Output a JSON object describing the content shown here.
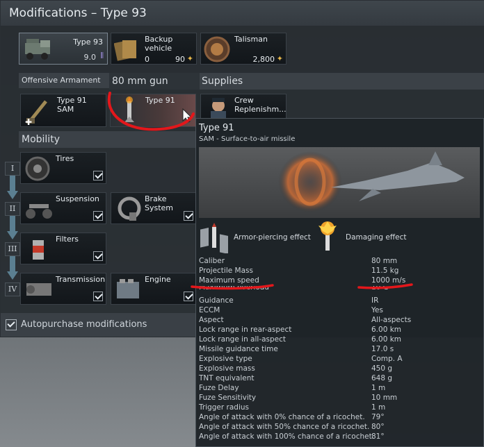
{
  "window": {
    "title": "Modifications – Type 93"
  },
  "top_cards": [
    {
      "name": "Type 93",
      "value": "9.0",
      "icon": "truck-icon"
    },
    {
      "name": "Backup vehicle",
      "count": "0",
      "price": "90",
      "icon": "cards-icon"
    },
    {
      "name": "Talisman",
      "price": "2,800",
      "icon": "medal-icon"
    }
  ],
  "sections": {
    "offensive": "Offensive Armament",
    "gun": "80 mm gun",
    "supplies": "Supplies",
    "mobility": "Mobility"
  },
  "weapons": [
    {
      "name": "Type 91",
      "sub": "SAM",
      "icon": "sam-launcher-icon"
    },
    {
      "name": "Type 91",
      "icon": "missile-icon"
    }
  ],
  "supplies": [
    {
      "name": "Crew Replenishm...",
      "icon": "crew-icon"
    }
  ],
  "mobility": [
    {
      "name": "Tires",
      "icon": "tire-icon"
    },
    {
      "name": "Suspension",
      "icon": "suspension-icon"
    },
    {
      "name": "Brake System",
      "icon": "brake-icon"
    },
    {
      "name": "Filters",
      "icon": "filter-icon"
    },
    {
      "name": "Transmission",
      "icon": "transmission-icon"
    },
    {
      "name": "Engine",
      "icon": "engine-icon"
    }
  ],
  "tiers": [
    "I",
    "II",
    "III",
    "IV"
  ],
  "autopurchase": "Autopurchase modifications",
  "tooltip": {
    "title": "Type 91",
    "subtitle": "SAM - Surface-to-air missile",
    "effects": [
      "Armor-piercing effect",
      "Damaging effect"
    ],
    "stats": [
      [
        "Caliber",
        "80 mm"
      ],
      [
        "Projectile Mass",
        "11.5 kg"
      ],
      [
        "Maximum speed",
        "1000 m/s"
      ],
      [
        "Maximum overload",
        "10 G"
      ],
      [
        "Guidance",
        "IR"
      ],
      [
        "ECCM",
        "Yes"
      ],
      [
        "Aspect",
        "All-aspects"
      ],
      [
        "Lock range in rear-aspect",
        "6.00 km"
      ],
      [
        "Lock range in all-aspect",
        "6.00 km"
      ],
      [
        "Missile guidance time",
        "17.0 s"
      ],
      [
        "Explosive type",
        "Comp. A"
      ],
      [
        "Explosive mass",
        "450 g"
      ],
      [
        "TNT equivalent",
        "648 g"
      ],
      [
        "Fuze Delay",
        "1 m"
      ],
      [
        "Fuze Sensitivity",
        "10 mm"
      ],
      [
        "Trigger radius",
        "1 m"
      ],
      [
        "Angle of attack with 0% chance of a ricochet.",
        "79°"
      ],
      [
        "Angle of attack with 50% chance of a ricochet.",
        "80°"
      ],
      [
        "Angle of attack with 100% chance of a ricochet.",
        "81°"
      ]
    ]
  },
  "colors": {
    "annotation": "#e3171b",
    "gold": "#e9b84a",
    "purple": "#a793e8"
  }
}
